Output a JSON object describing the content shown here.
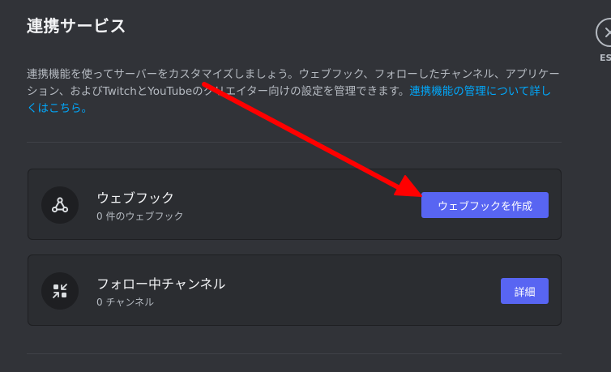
{
  "page": {
    "title": "連携サービス",
    "description_main": "連携機能を使ってサーバーをカスタマイズしましょう。ウェブフック、フォローしたチャンネル、アプリケーション、およびTwitchとYouTubeのクリエイター向けの設定を管理できます。",
    "description_link": "連携機能の管理について詳しくはこちら。"
  },
  "close": {
    "label": "ESC",
    "icon": "close-icon"
  },
  "webhooks": {
    "title": "ウェブフック",
    "subtitle": "0 件のウェブフック",
    "button_label": "ウェブフックを作成",
    "icon": "webhook-icon"
  },
  "following": {
    "title": "フォロー中チャンネル",
    "subtitle": "0 チャンネル",
    "button_label": "詳細",
    "icon": "follow-channel-icon"
  },
  "annotation": {
    "arrow_color": "#ff0000"
  },
  "colors": {
    "background": "#313338",
    "card": "#2b2d31",
    "accent": "#5865f2",
    "link": "#00a8fc"
  }
}
